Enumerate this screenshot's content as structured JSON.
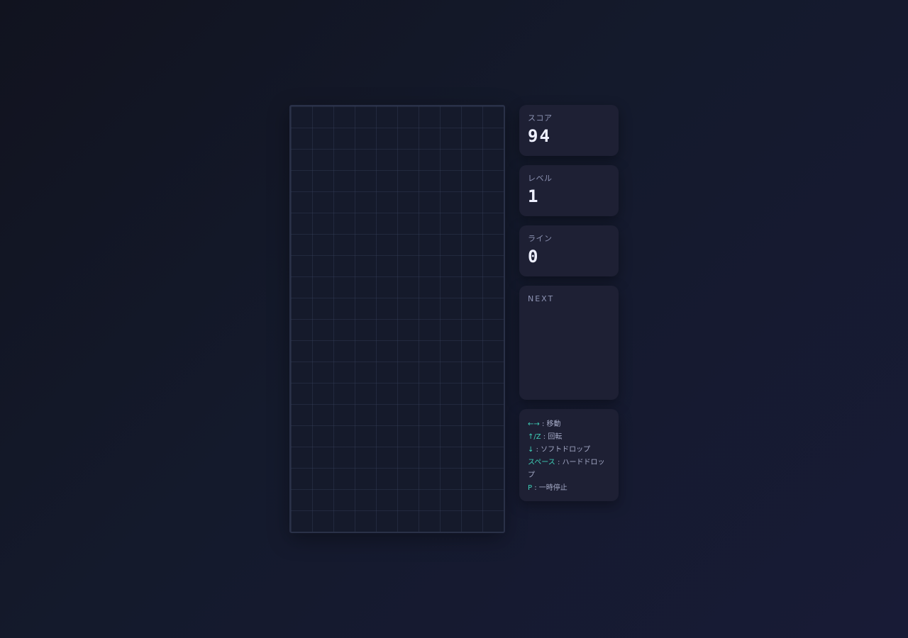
{
  "board": {
    "columns": 10,
    "rows": 20
  },
  "stats": {
    "score_label": "スコア",
    "score_value": "94",
    "level_label": "レベル",
    "level_value": "1",
    "lines_label": "ライン",
    "lines_value": "0"
  },
  "next": {
    "label": "NEXT"
  },
  "controls": [
    {
      "key": "←→",
      "desc": " : 移動"
    },
    {
      "key": "↑/Z",
      "desc": " : 回転"
    },
    {
      "key": "↓",
      "desc": " : ソフトドロップ"
    },
    {
      "key": "スペース",
      "desc": " : ハードドロップ"
    },
    {
      "key": "P",
      "desc": " : 一時停止"
    }
  ],
  "colors": {
    "accent": "#3fd0b8",
    "panel": "#1e2034",
    "board": "#151a2b"
  }
}
